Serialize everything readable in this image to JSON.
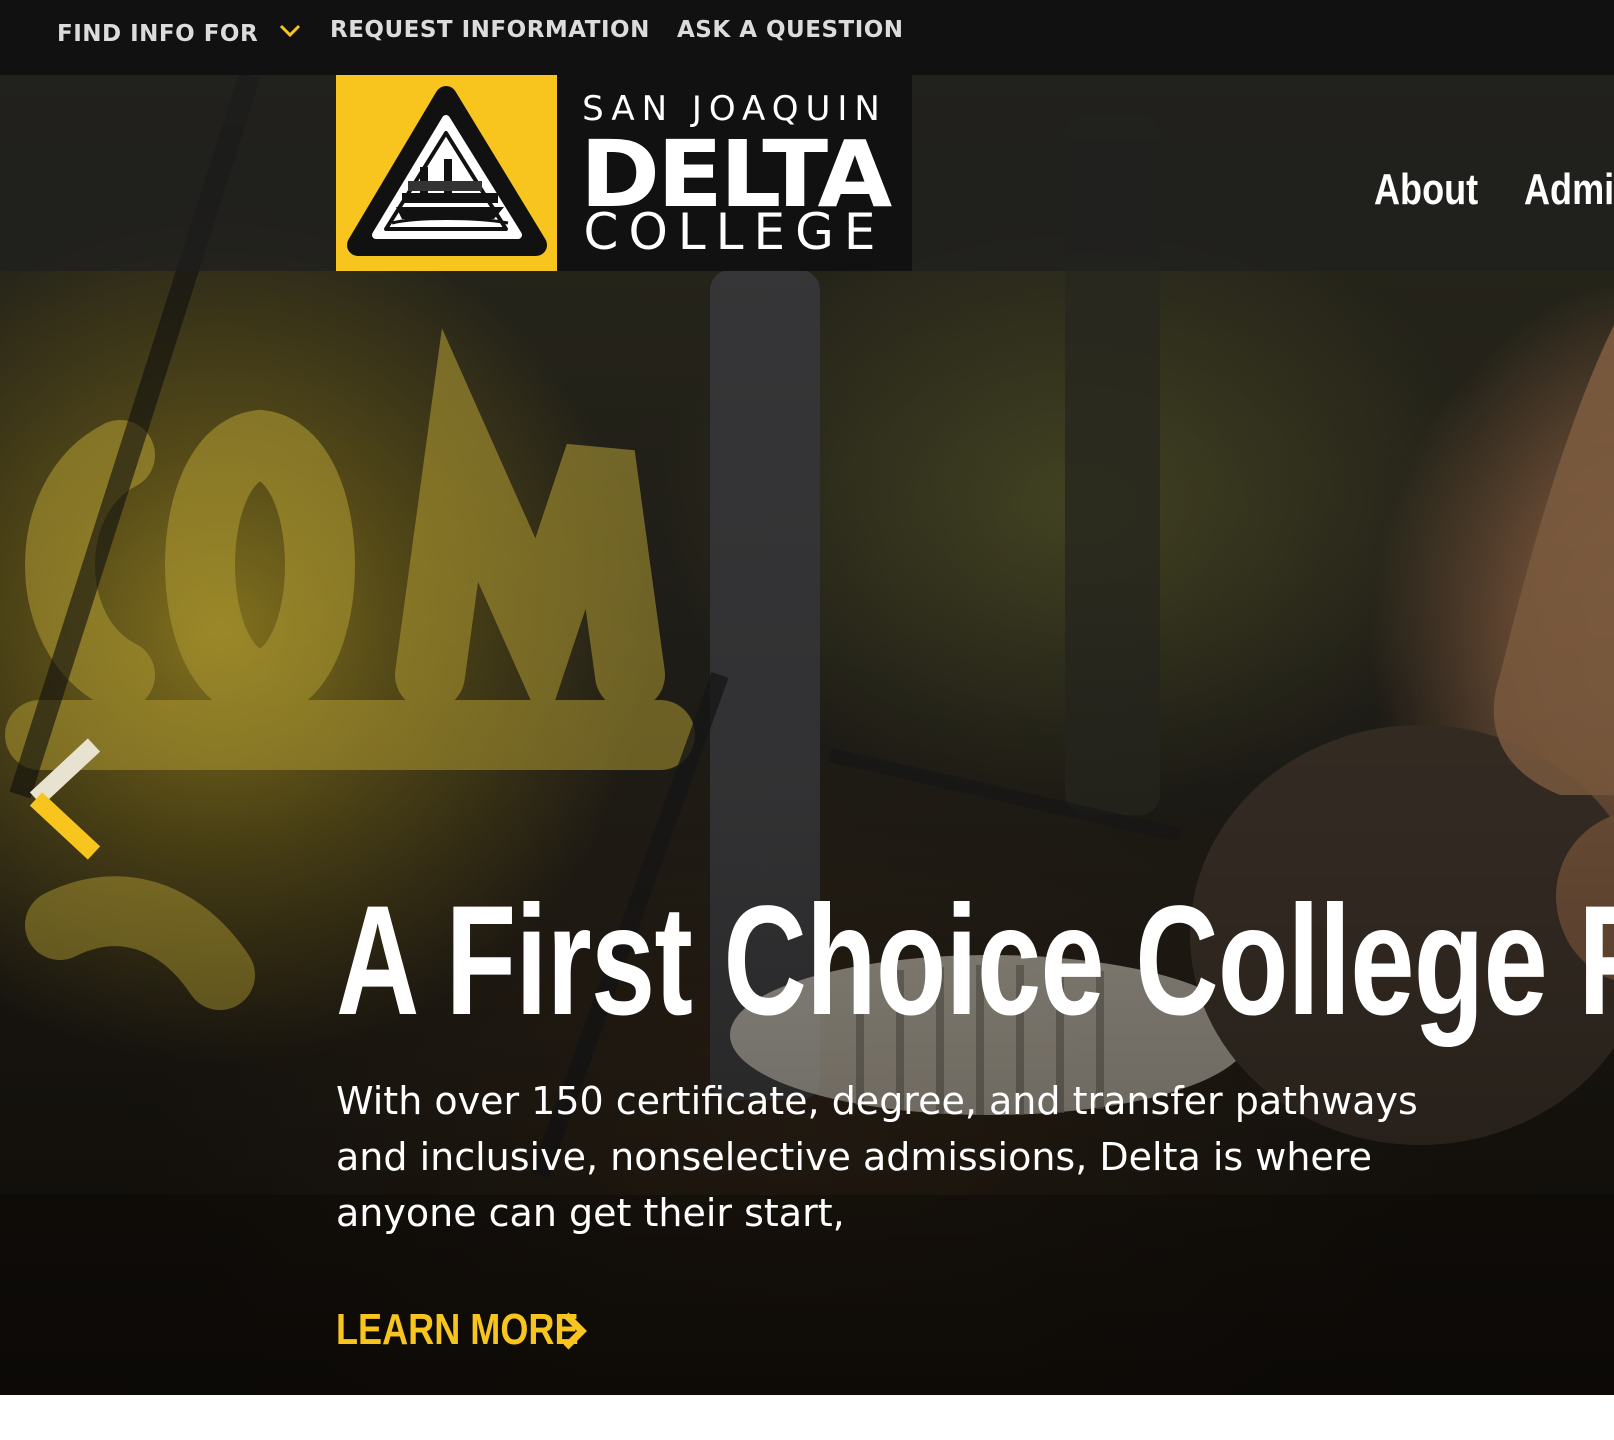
{
  "utility_bar": {
    "find_info_label": "FIND INFO FOR",
    "request_info_label": "REQUEST INFORMATION",
    "ask_question_label": "ASK A QUESTION"
  },
  "logo": {
    "line1": "SAN JOAQUIN",
    "line2": "DELTA",
    "line3": "COLLEGE"
  },
  "main_nav": {
    "about_label": "About",
    "admissions_label": "Admis"
  },
  "hero": {
    "title": "A First Choice College Fo",
    "description": "With over 150 certificate, degree, and transfer pathways and inclusive, nonselective admissions, Delta is where anyone can get their start,",
    "cta_label": "LEARN MORE"
  },
  "colors": {
    "brand_gold": "#f7c51e",
    "utility_bar_bg": "#111111",
    "text_light": "#ffffff"
  },
  "icons": {
    "find_info_toggle": "chevron-down-icon",
    "carousel_prev": "chevron-left-icon",
    "cta_arrow": "chevron-right-icon",
    "logo_emblem": "steamboat-emblem-icon"
  }
}
